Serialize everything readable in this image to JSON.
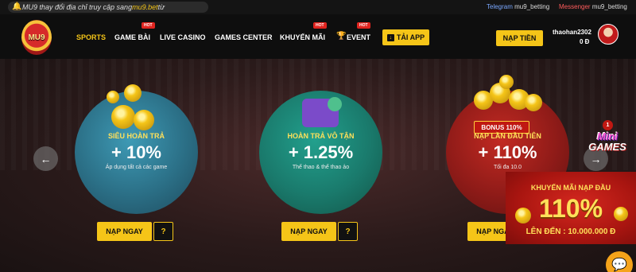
{
  "ticker": {
    "prefix": "MU9 thay đổi địa chỉ truy cập sang ",
    "domain": "mu9.bet",
    "suffix": " từ"
  },
  "contacts": {
    "telegram_label": "Telegram",
    "telegram_handle": "mu9_betting",
    "messenger_label": "Messenger",
    "messenger_handle": "mu9_betting"
  },
  "logo_text": "MU9",
  "nav": {
    "items": [
      {
        "label": "SPORTS"
      },
      {
        "label": "GAME BÀI"
      },
      {
        "label": "LIVE CASINO"
      },
      {
        "label": "GAMES CENTER"
      },
      {
        "label": "KHUYẾN MÃI"
      },
      {
        "label": "EVENT"
      }
    ],
    "hot_badge": "HOT"
  },
  "header": {
    "app_button": "TẢI APP",
    "deposit_button": "NẠP TIỀN",
    "username": "thaohan2302",
    "balance": "0 Đ"
  },
  "promos": [
    {
      "title": "SIÊU HOÀN TRẢ",
      "value": "+ 10%",
      "subtitle": "Áp dụng tất cả các game"
    },
    {
      "title": "HOÀN TRẢ VÔ TẬN",
      "value": "+ 1.25%",
      "subtitle": "Thể thao & thể thao ảo"
    },
    {
      "title": "NẠP LẦN ĐẦU TIÊN",
      "value": "+ 110%",
      "subtitle": "Tối đa 10.0"
    }
  ],
  "promo_buttons": {
    "deposit": "NẠP NGAY",
    "help": "?"
  },
  "bonus_ribbon": "BONUS 110%",
  "minigames": {
    "mini": "Mini",
    "games": "GAMES",
    "badge": "1"
  },
  "popup": {
    "title": "KHUYẾN MÃI NẠP ĐẦU",
    "value": "110%",
    "subtitle": "LÊN ĐẾN : 10.000.000 Đ"
  },
  "colors": {
    "accent": "#f5c518",
    "header_bg": "#0e0e0e",
    "hot": "#e0241f"
  }
}
